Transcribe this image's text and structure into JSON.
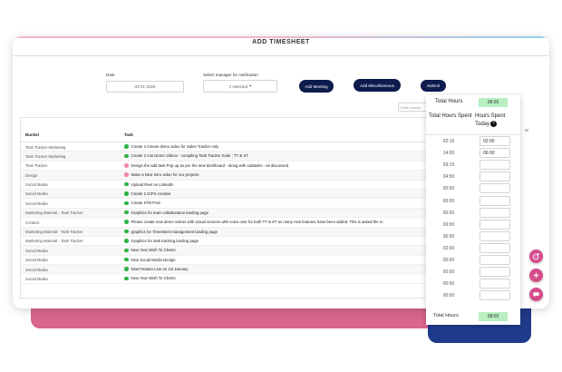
{
  "header": {
    "title": "ADD TIMESHEET"
  },
  "form": {
    "date_label": "Date",
    "date_value": "03-01-2025",
    "manager_label": "Select manager for notification",
    "manager_value": "2 selected",
    "add_meeting": "Add Meeting",
    "add_misc": "Add Miscellaneous",
    "submit": "Submit",
    "search_placeholder": "Enter bucket"
  },
  "table": {
    "columns": [
      "Bucket",
      "Task"
    ],
    "right_stub": "nt",
    "rows": [
      {
        "bucket": "Task Tracker Marketing",
        "task": "Create 2 minute demo video for Sales Tracker only",
        "status": "green"
      },
      {
        "bucket": "Task Tracker Marketing",
        "task": "Create 2 min Demo Videos - compiling Task Tracker Suite ; TT & ST",
        "status": "green"
      },
      {
        "bucket": "Task Tracker",
        "task": "Design the add task Pop up as per the new dashboard - along with subtasks - as discussed",
        "status": "pink"
      },
      {
        "bucket": "Design",
        "task": "Make a New Intro video for our projects",
        "status": "pink"
      },
      {
        "bucket": "Social Media",
        "task": "Upload Reel on LinkedIn",
        "status": "green"
      },
      {
        "bucket": "Social Media",
        "task": "Create 2 GIFS creative",
        "status": "green"
      },
      {
        "bucket": "Social Media",
        "task": "Create KTB Post",
        "status": "green"
      },
      {
        "bucket": "Marketing Material - Task Tracker",
        "task": "Graphics for team collaboration landing page",
        "status": "green"
      },
      {
        "bucket": "Content",
        "task": "Please create new demo videos with actual screens with voice over for both TT & ST as many new features have been added. This is asked the m",
        "status": "green"
      },
      {
        "bucket": "Marketing Material - Task Tracker",
        "task": "graphics for Timesheet management landing page",
        "status": "green"
      },
      {
        "bucket": "Marketing Material - Task Tracker",
        "task": "Graphics for task tracking landing page",
        "status": "green"
      },
      {
        "bucket": "Social Media",
        "task": "New Year Wish To Clients",
        "status": "green"
      },
      {
        "bucket": "Social Media",
        "task": "New Social Media Design",
        "status": "green"
      },
      {
        "bucket": "Social Media",
        "task": "New Feature Live on 1st January",
        "status": "green"
      },
      {
        "bucket": "Social Media",
        "task": "New Year Wish To Clients",
        "status": "green"
      }
    ]
  },
  "hours_panel": {
    "total_label_top": "Total Hours",
    "total_value_top": "08:00",
    "col_spent": "Total Hours Spent",
    "col_today": "Hours Spent Today",
    "help_icon": "question-icon",
    "rows": [
      {
        "spent": "02:15",
        "today": "02:00"
      },
      {
        "spent": "14:00",
        "today": "06:00"
      },
      {
        "spent": "59:15",
        "today": ""
      },
      {
        "spent": "34:50",
        "today": ""
      },
      {
        "spent": "00:00",
        "today": ""
      },
      {
        "spent": "00:00",
        "today": ""
      },
      {
        "spent": "00:00",
        "today": ""
      },
      {
        "spent": "00:00",
        "today": ""
      },
      {
        "spent": "06:00",
        "today": ""
      },
      {
        "spent": "02:00",
        "today": ""
      },
      {
        "spent": "00:00",
        "today": ""
      },
      {
        "spent": "00:00",
        "today": ""
      },
      {
        "spent": "00:00",
        "today": ""
      },
      {
        "spent": "00:00",
        "today": ""
      }
    ],
    "total_label_bottom": "Total Hours",
    "total_value_bottom": "08:00"
  },
  "fabs": [
    {
      "name": "timer-add-icon"
    },
    {
      "name": "plus-icon"
    },
    {
      "name": "chat-icon"
    }
  ],
  "colors": {
    "accent_navy": "#0d1b4d",
    "accent_pink": "#d64b8a",
    "chip_green": "#b9efc1",
    "status_green": "#2fb344",
    "status_pink": "#f08aa5"
  }
}
